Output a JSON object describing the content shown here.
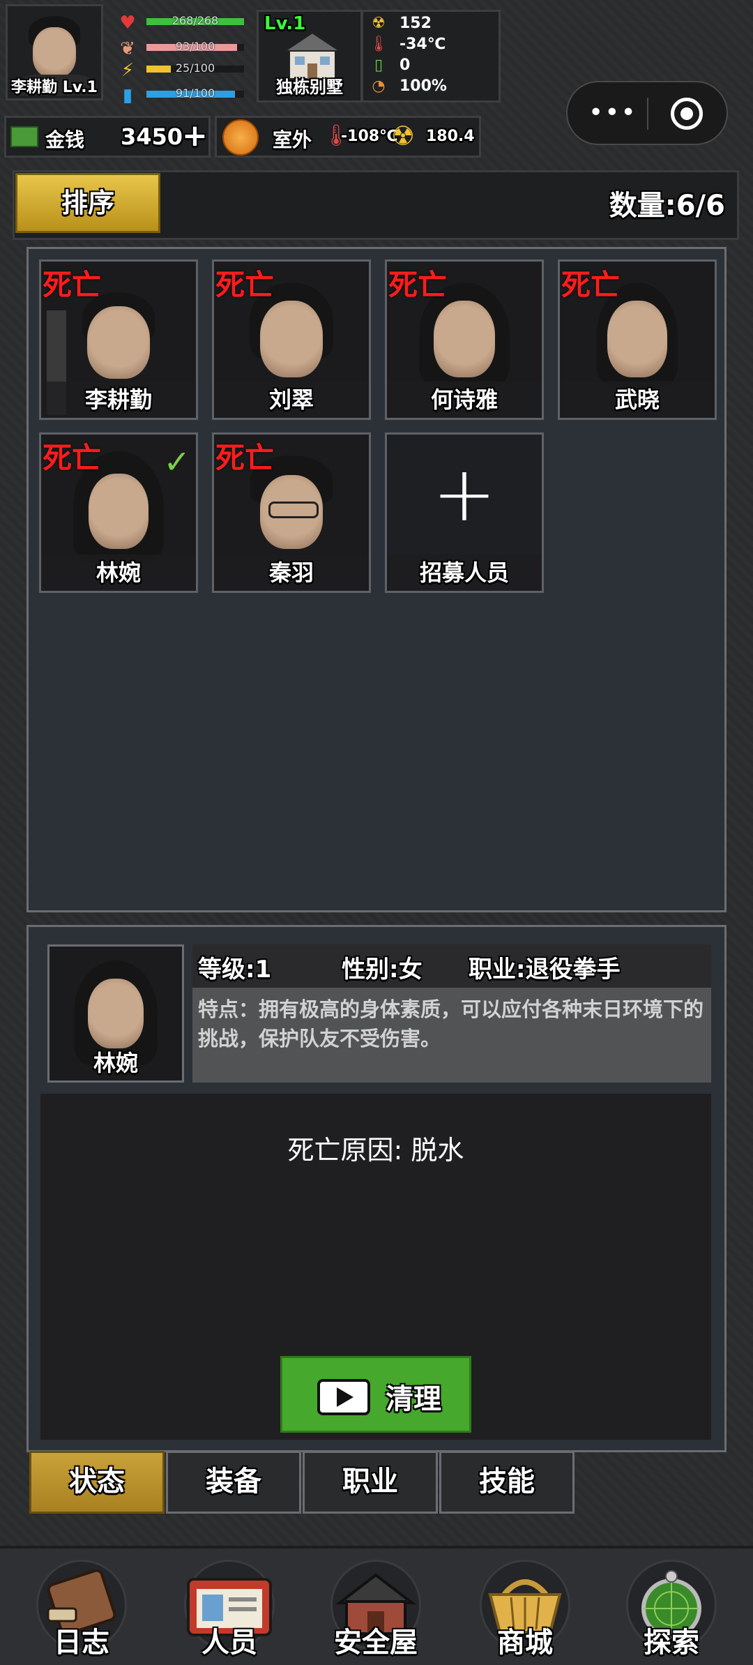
{
  "player": {
    "name_level": "李耕勤 Lv.1"
  },
  "stats": {
    "health": {
      "text": "268/268",
      "ratio": 1.0,
      "color": "#3fbf3f"
    },
    "hunger": {
      "text": "93/100",
      "ratio": 0.93,
      "color": "#e89a9a"
    },
    "energy": {
      "text": "25/100",
      "ratio": 0.25,
      "color": "#f2c230"
    },
    "water": {
      "text": "91/100",
      "ratio": 0.91,
      "color": "#2aa0e8"
    }
  },
  "house": {
    "level": "Lv.1",
    "name": "独栋别墅"
  },
  "env": {
    "radiation": "152",
    "temperature": "-34℃",
    "battery": "0",
    "percent": "100%"
  },
  "money": {
    "label": "金钱",
    "value": "3450",
    "add": "+"
  },
  "outside": {
    "label": "室外",
    "temperature": "-108℃",
    "radiation": "180.4"
  },
  "capsule": {
    "dots": "•••"
  },
  "roster": {
    "sort_label": "排序",
    "count": "数量:6/6",
    "dead_label": "死亡",
    "members": [
      {
        "name": "李耕勤"
      },
      {
        "name": "刘翠"
      },
      {
        "name": "何诗雅"
      },
      {
        "name": "武晓"
      },
      {
        "name": "林婉"
      },
      {
        "name": "秦羽"
      }
    ],
    "recruit": {
      "plus": "+",
      "label": "招募人员"
    },
    "check": "✓"
  },
  "detail": {
    "name": "林婉",
    "level": "等级:1",
    "gender": "性别:女",
    "job": "职业:退役拳手",
    "description": "特点：拥有极高的身体素质，可以应付各种末日环境下的挑战，保护队友不受伤害。",
    "death_reason": "死亡原因: 脱水",
    "clean_label": "清理"
  },
  "tabs": [
    {
      "label": "状态"
    },
    {
      "label": "装备"
    },
    {
      "label": "职业"
    },
    {
      "label": "技能"
    }
  ],
  "nav": [
    {
      "label": "日志",
      "icon": "journal-icon"
    },
    {
      "label": "人员",
      "icon": "id-card-icon"
    },
    {
      "label": "安全屋",
      "icon": "house-icon"
    },
    {
      "label": "商城",
      "icon": "basket-icon"
    },
    {
      "label": "探索",
      "icon": "radar-icon"
    }
  ]
}
